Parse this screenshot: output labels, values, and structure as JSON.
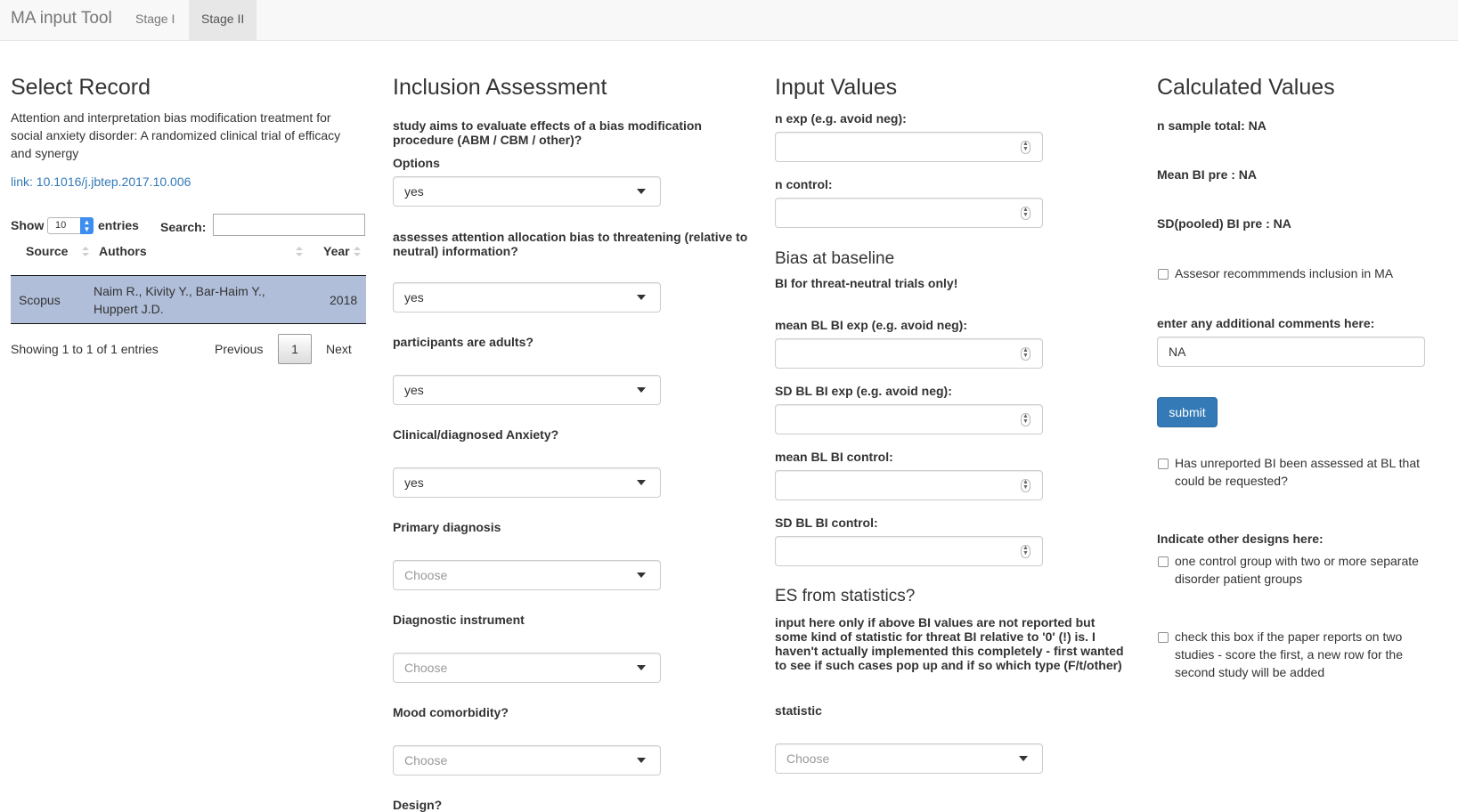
{
  "navbar": {
    "brand": "MA input Tool",
    "tabs": [
      "Stage I",
      "Stage II"
    ]
  },
  "select_record": {
    "title": "Select Record",
    "record_title": "Attention and interpretation bias modification treatment for social anxiety disorder: A randomized clinical trial of efficacy and synergy",
    "link_text": "link: 10.1016/j.jbtep.2017.10.006",
    "show_label": "Show",
    "show_value": "10",
    "entries_label": "entries",
    "search_label": "Search:",
    "search_value": "",
    "columns": [
      "Source",
      "Authors",
      "Year"
    ],
    "rows": [
      {
        "source": "Scopus",
        "authors_line1": "Naim R., Kivity Y., Bar-Haim Y.,",
        "authors_line2": "Huppert J.D.",
        "year": "2018"
      }
    ],
    "info": "Showing 1 to 1 of 1 entries",
    "previous": "Previous",
    "page": "1",
    "next": "Next"
  },
  "inclusion": {
    "title": "Inclusion Assessment",
    "q1": "study aims to evaluate effects of a bias modification procedure (ABM / CBM / other)?",
    "options_label": "Options",
    "q1_value": "yes",
    "q2": "assesses attention allocation bias to threatening (relative to neutral) information?",
    "q2_value": "yes",
    "q3": "participants are adults?",
    "q3_value": "yes",
    "q4": "Clinical/diagnosed Anxiety?",
    "q4_value": "yes",
    "q5": "Primary diagnosis",
    "q5_value": "Choose",
    "q6": "Diagnostic instrument",
    "q6_value": "Choose",
    "q7": "Mood comorbidity?",
    "q7_value": "Choose",
    "q8": "Design?"
  },
  "input_values": {
    "title": "Input Values",
    "n_exp": "n exp (e.g. avoid neg):",
    "n_control": "n control:",
    "bias_title": "Bias at baseline",
    "bias_note": "BI for threat-neutral trials only!",
    "mean_bl_exp": "mean BL BI exp (e.g. avoid neg):",
    "sd_bl_exp": "SD BL BI exp (e.g. avoid neg):",
    "mean_bl_control": "mean BL BI control:",
    "sd_bl_control": "SD BL BI control:",
    "es_title": "ES from statistics?",
    "es_note": "input here only if above BI values are not reported but some kind of statistic for threat BI relative to '0' (!) is. I haven't actually implemented this completely - first wanted to see if such cases pop up and if so which type (F/t/other)",
    "statistic_label": "statistic",
    "statistic_value": "Choose"
  },
  "calculated": {
    "title": "Calculated Values",
    "n_total": "n sample total: NA",
    "mean_bi": "Mean BI pre : NA",
    "sd_bi": "SD(pooled) BI pre : NA",
    "recommend": "Assesor recommmends inclusion in MA",
    "comments_label": "enter any additional comments here:",
    "comments_value": "NA",
    "submit": "submit",
    "unreported": "Has unreported BI been assessed at BL that could be requested?",
    "other_designs_label": "Indicate other designs here:",
    "design1": "one control group with two or more separate disorder patient groups",
    "design2": "check this box if the paper reports on two studies - score the first, a new row for the second study will be added"
  },
  "colors": {
    "accent": "#337ab7",
    "selected_row": "#b0bed9",
    "navbar_bg": "#f8f8f8"
  }
}
